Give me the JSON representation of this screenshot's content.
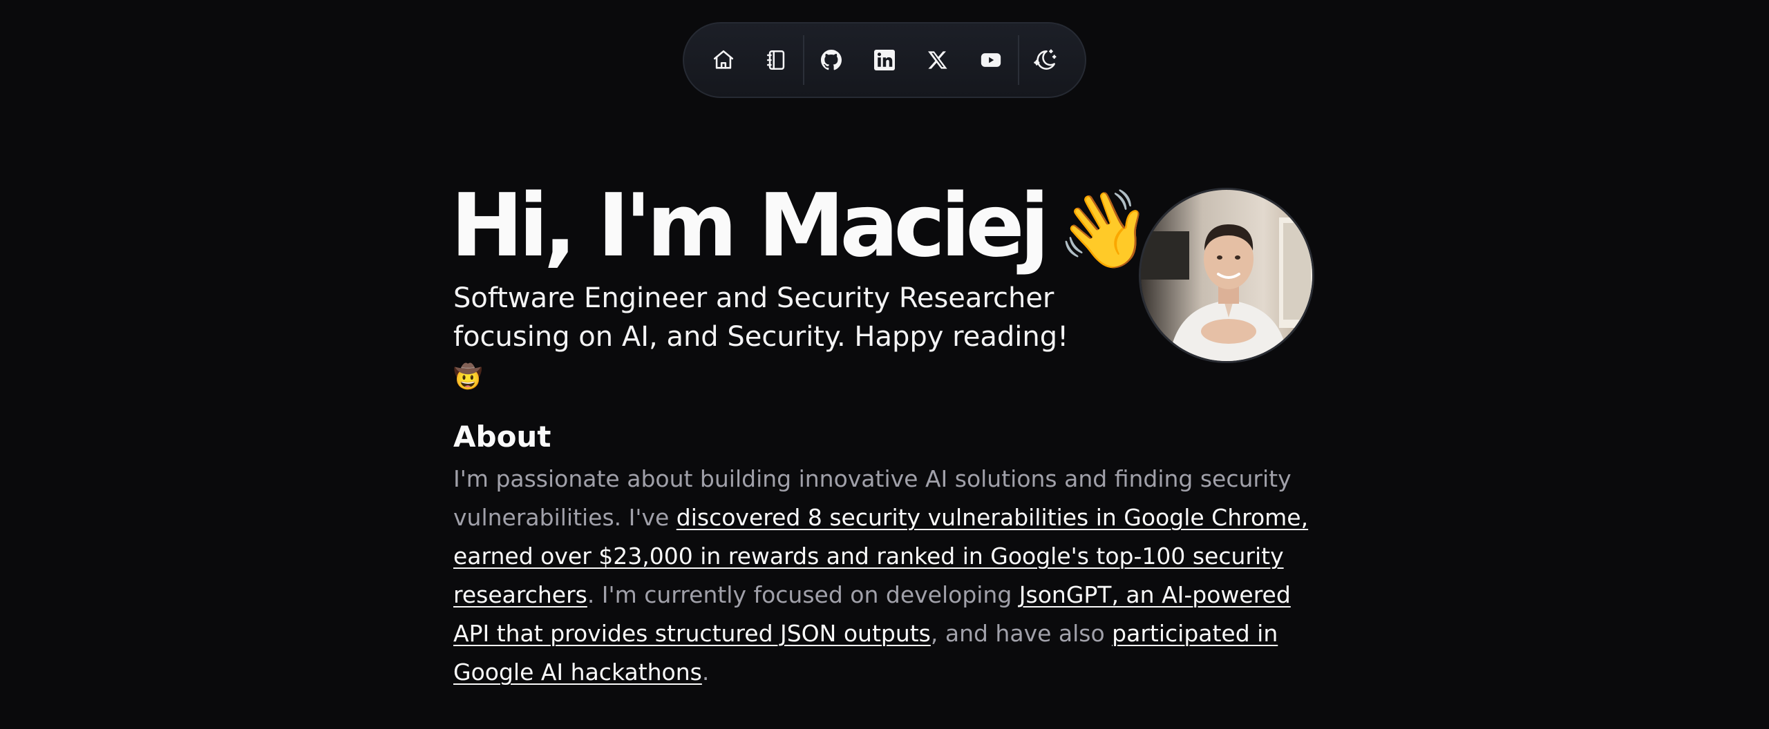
{
  "nav": {
    "items": [
      {
        "icon": "home-icon"
      },
      {
        "icon": "notebook-icon"
      },
      {
        "icon": "github-icon"
      },
      {
        "icon": "linkedin-icon"
      },
      {
        "icon": "x-icon"
      },
      {
        "icon": "youtube-icon"
      },
      {
        "icon": "moon-stars-icon"
      }
    ]
  },
  "hero": {
    "title": "Hi, I'm Maciej",
    "title_emoji": "👋",
    "subtitle": "Software Engineer and Security Researcher focusing on AI, and Security. Happy reading!",
    "subtitle_emoji": "🤠"
  },
  "about": {
    "heading": "About",
    "text_1": "I'm passionate about building innovative AI solutions and finding security vulnerabilities. I've ",
    "link_1": "discovered 8 security vulnerabilities in Google Chrome, earned over $23,000 in rewards and ranked in Google's top-100 security researchers",
    "text_2": ". I'm currently focused on developing ",
    "link_2": "JsonGPT, an AI-powered API that provides structured JSON outputs",
    "text_3": ", and have also ",
    "link_3": "participated in Google AI hackathons",
    "text_4": "."
  },
  "colors": {
    "background": "#0a0a0c",
    "text_primary": "#fafafa",
    "text_muted": "#a1a1aa",
    "dock_bg": "#1c1f27"
  }
}
